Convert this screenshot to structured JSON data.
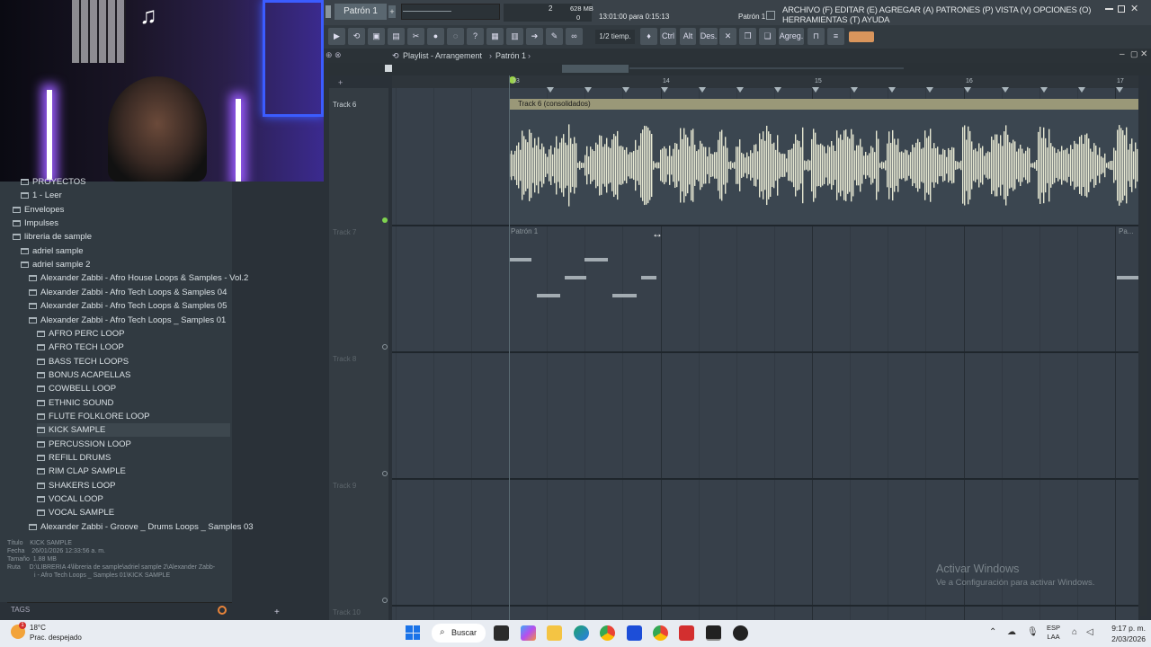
{
  "webcam": {
    "note_glyph": "♫"
  },
  "topbar": {
    "pattern": "Patrón 1",
    "tempo_value": "2",
    "memory": "628 MB",
    "mem_sub": "0",
    "hint": "13:01:00 para 0:15:13",
    "pattern_right": "Patrón 1",
    "menu": "ARCHIVO (F) EDITAR (E) AGREGAR (A) PATRONES (P) VISTA (V) OPCIONES (O) HERRAMIENTAS (T) AYUDA"
  },
  "toolbar": {
    "snap_label": "1/2 tiemp.",
    "ctrl": "Ctrl",
    "alt": "Alt",
    "des": "Des.",
    "agreg": "Agreg."
  },
  "playlist": {
    "breadcrumb": "Playlist - Arrangement",
    "pattern": "Patrón 1",
    "bar_numbers": [
      "13",
      "14",
      "15",
      "16",
      "17"
    ],
    "tracks": [
      {
        "name": "Track 6",
        "dim": false
      },
      {
        "name": "Track 7",
        "dim": true
      },
      {
        "name": "Track 8",
        "dim": true
      },
      {
        "name": "Track 9",
        "dim": true
      },
      {
        "name": "Track 10",
        "dim": true
      }
    ],
    "audio_clip_title": "Track 6 (consolidados)",
    "pattern_clip_title": "Patrón 1",
    "pattern_clip_short": "Pa..."
  },
  "browser": {
    "items": [
      {
        "label": "PROYECTOS",
        "level": 1
      },
      {
        "label": "1 - Leer",
        "level": 1
      },
      {
        "label": "Envelopes",
        "level": 0
      },
      {
        "label": "Impulses",
        "level": 0
      },
      {
        "label": "libreria de sample",
        "level": 0
      },
      {
        "label": "adriel sample",
        "level": 1
      },
      {
        "label": "adriel sample 2",
        "level": 1
      },
      {
        "label": "Alexander Zabbi - Afro House Loops & Samples - Vol.2",
        "level": 2
      },
      {
        "label": "Alexander Zabbi - Afro Tech Loops & Samples 04",
        "level": 2
      },
      {
        "label": "Alexander Zabbi - Afro Tech Loops & Samples 05",
        "level": 2
      },
      {
        "label": "Alexander Zabbi - Afro Tech Loops _ Samples 01",
        "level": 2
      },
      {
        "label": "AFRO PERC LOOP",
        "level": 3
      },
      {
        "label": "AFRO TECH LOOP",
        "level": 3
      },
      {
        "label": "BASS TECH LOOPS",
        "level": 3
      },
      {
        "label": "BONUS ACAPELLAS",
        "level": 3
      },
      {
        "label": "COWBELL LOOP",
        "level": 3
      },
      {
        "label": "ETHNIC SOUND",
        "level": 3
      },
      {
        "label": "FLUTE FOLKLORE LOOP",
        "level": 3
      },
      {
        "label": "KICK SAMPLE",
        "level": 3
      },
      {
        "label": "PERCUSSION LOOP",
        "level": 3
      },
      {
        "label": "REFILL DRUMS",
        "level": 3
      },
      {
        "label": "RIM CLAP SAMPLE",
        "level": 3
      },
      {
        "label": "SHAKERS LOOP",
        "level": 3
      },
      {
        "label": "VOCAL LOOP",
        "level": 3
      },
      {
        "label": "VOCAL SAMPLE",
        "level": 3
      },
      {
        "label": "Alexander Zabbi - Groove _ Drums Loops _ Samples 03",
        "level": 2
      }
    ],
    "info": {
      "title_label": "Título",
      "title": "KICK SAMPLE",
      "date_label": "Fecha",
      "date": "26/01/2026 12:33:56 a. m.",
      "size_label": "Tamaño",
      "size": "1.88 MB",
      "path_label": "Ruta",
      "path1": "D:\\LIBRERIA 4\\libreria de sample\\adriel sample 2\\Alexander Zabb-",
      "path2": "i - Afro Tech Loops _ Samples 01\\KICK SAMPLE"
    },
    "tags_label": "TAGS"
  },
  "watermark": {
    "line1": "Activar Windows",
    "line2": "Ve a Configuración para activar Windows."
  },
  "taskbar": {
    "temp": "18°C",
    "weather": "Prac. despejado",
    "search": "Buscar",
    "lang1": "ESP",
    "lang2": "LAA",
    "time": "9:17 p. m.",
    "date": "2/03/2026"
  }
}
